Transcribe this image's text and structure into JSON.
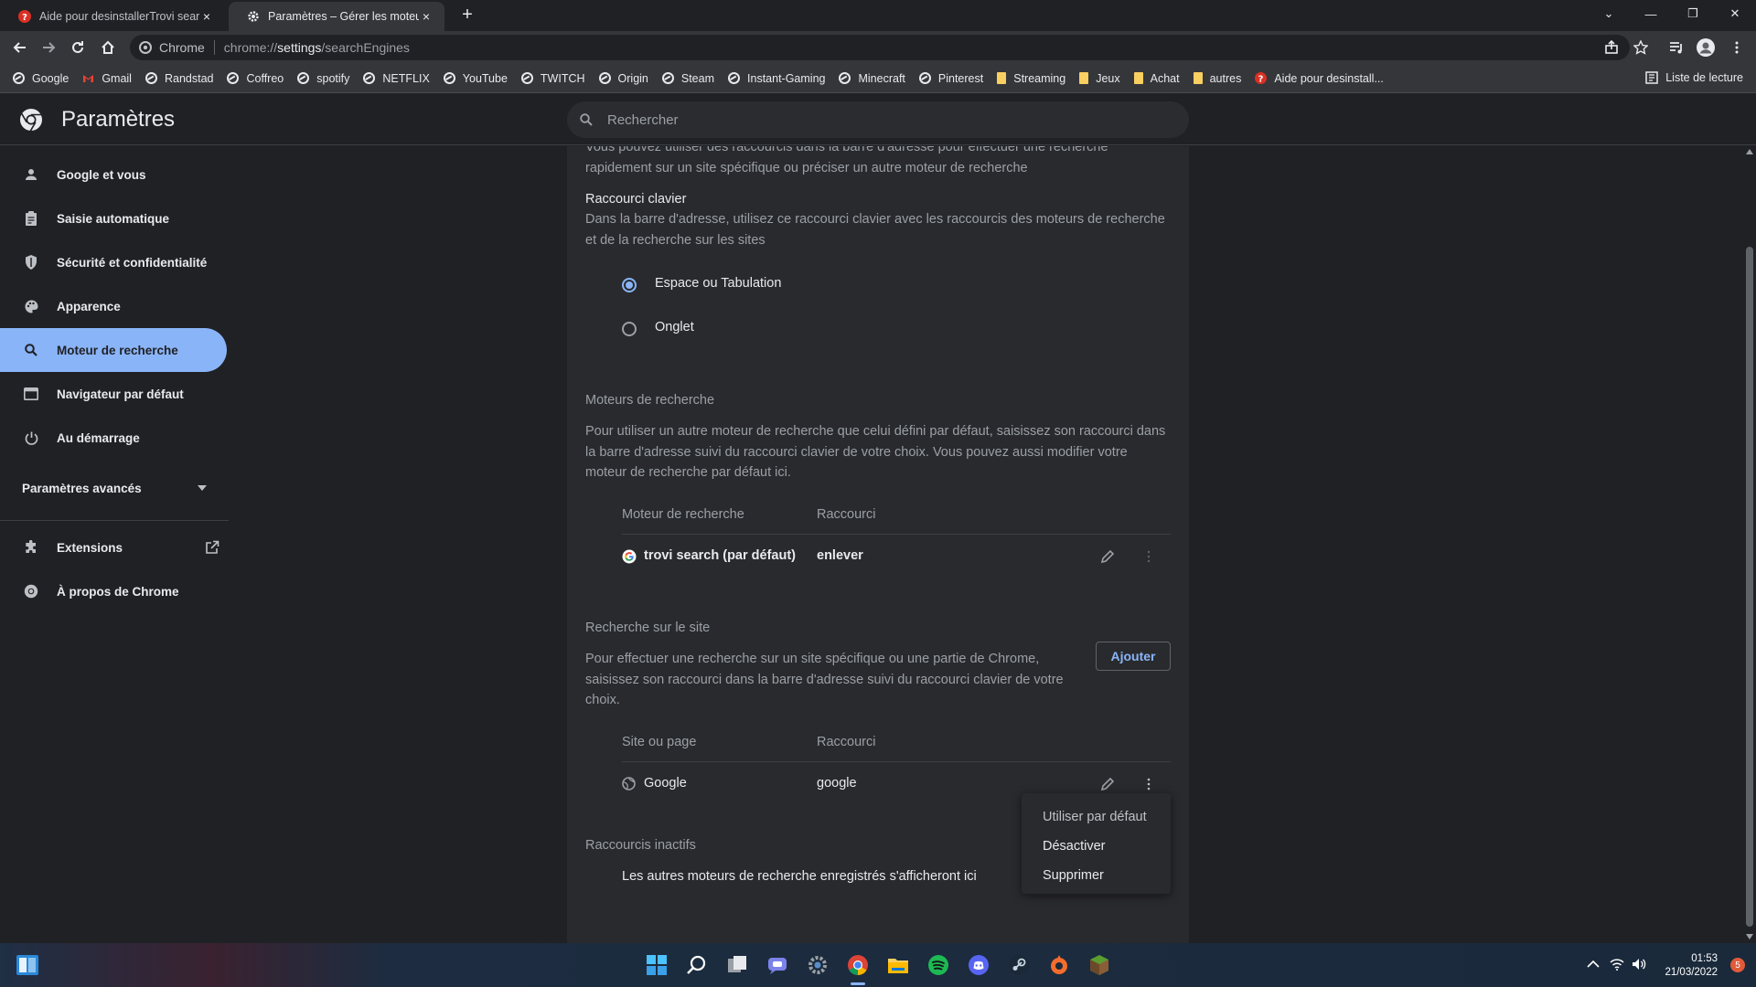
{
  "tabs": [
    {
      "title": "Aide pour desinstallerTrovi search",
      "close": "×"
    },
    {
      "title": "Paramètres – Gérer les moteurs de recherche",
      "close": "×"
    }
  ],
  "newtab": "+",
  "window_controls": {
    "dropdown": "⌄",
    "minimize": "—",
    "restore": "❐",
    "close": "✕"
  },
  "omnibox": {
    "scheme": "Chrome",
    "url_prefix": "chrome://",
    "url_path": "settings",
    "url_rest": "/searchEngines"
  },
  "bookmarks": [
    {
      "label": "Google",
      "icon": "globe"
    },
    {
      "label": "Gmail",
      "icon": "gmail"
    },
    {
      "label": "Randstad",
      "icon": "globe"
    },
    {
      "label": "Coffreo",
      "icon": "globe"
    },
    {
      "label": "spotify",
      "icon": "globe"
    },
    {
      "label": "NETFLIX",
      "icon": "globe"
    },
    {
      "label": "YouTube",
      "icon": "globe"
    },
    {
      "label": "TWITCH",
      "icon": "globe"
    },
    {
      "label": "Origin",
      "icon": "globe"
    },
    {
      "label": "Steam",
      "icon": "globe"
    },
    {
      "label": "Instant-Gaming",
      "icon": "globe"
    },
    {
      "label": "Minecraft",
      "icon": "globe"
    },
    {
      "label": "Pinterest",
      "icon": "globe"
    },
    {
      "label": "Streaming",
      "icon": "folder"
    },
    {
      "label": "Jeux",
      "icon": "folder"
    },
    {
      "label": "Achat",
      "icon": "folder"
    },
    {
      "label": "autres",
      "icon": "folder"
    },
    {
      "label": "Aide pour desinstall...",
      "icon": "help"
    }
  ],
  "reading_list": "Liste de lecture",
  "header": {
    "title": "Paramètres",
    "search_placeholder": "Rechercher"
  },
  "sidebar": {
    "items": [
      {
        "label": "Google et vous"
      },
      {
        "label": "Saisie automatique"
      },
      {
        "label": "Sécurité et confidentialité"
      },
      {
        "label": "Apparence"
      },
      {
        "label": "Moteur de recherche"
      },
      {
        "label": "Navigateur par défaut"
      },
      {
        "label": "Au démarrage"
      }
    ],
    "advanced": "Paramètres avancés",
    "extensions": "Extensions",
    "about": "À propos de Chrome"
  },
  "main": {
    "intro": "Vous pouvez utiliser des raccourcis dans la barre d'adresse pour effectuer une recherche rapidement sur un site spécifique ou préciser un autre moteur de recherche",
    "shortcut_title": "Raccourci clavier",
    "shortcut_desc": "Dans la barre d'adresse, utilisez ce raccourci clavier avec les raccourcis des moteurs de recherche et de la recherche sur les sites",
    "radio_space": "Espace ou Tabulation",
    "radio_tab": "Onglet",
    "engines_title": "Moteurs de recherche",
    "engines_desc": "Pour utiliser un autre moteur de recherche que celui défini par défaut, saisissez son raccourci dans la barre d'adresse suivi du raccourci clavier de votre choix. Vous pouvez aussi modifier votre moteur de recherche par défaut ici.",
    "col_engine": "Moteur de recherche",
    "col_shortcut": "Raccourci",
    "engine_row": {
      "name": "trovi search (par défaut)",
      "shortcut": "enlever"
    },
    "site_title": "Recherche sur le site",
    "site_desc": "Pour effectuer une recherche sur un site spécifique ou une partie de Chrome, saisissez son raccourci dans la barre d'adresse suivi du raccourci clavier de votre choix.",
    "add_button": "Ajouter",
    "col_site": "Site ou page",
    "col_site_shortcut": "Raccourci",
    "site_row": {
      "name": "Google",
      "shortcut": "google"
    },
    "inactive_title": "Raccourcis inactifs",
    "inactive_desc": "Les autres moteurs de recherche enregistrés s'afficheront ici"
  },
  "context_menu": [
    "Utiliser par défaut",
    "Désactiver",
    "Supprimer"
  ],
  "taskbar": {
    "time": "01:53",
    "date": "21/03/2022",
    "notifications": "5"
  },
  "colors": {
    "accent": "#8ab4f8",
    "background": "#202124",
    "card": "#292a2d",
    "toolbar": "#35363a"
  }
}
